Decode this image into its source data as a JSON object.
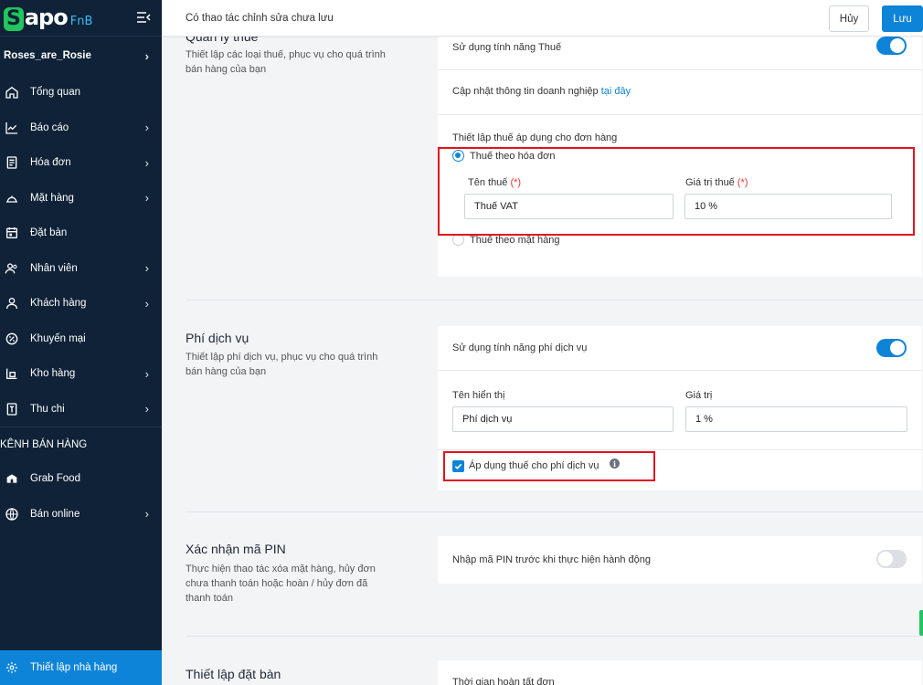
{
  "app": {
    "logo_s": "S",
    "logo_apo": "apo",
    "logo_fnb": "FnB",
    "store_name": "Roses_are_Rosie"
  },
  "sidebar": {
    "items": [
      {
        "label": "Tổng quan",
        "icon": "home-icon",
        "has_arrow": false
      },
      {
        "label": "Báo cáo",
        "icon": "chart-line-icon",
        "has_arrow": true
      },
      {
        "label": "Hóa đơn",
        "icon": "receipt-icon",
        "has_arrow": true
      },
      {
        "label": "Mặt hàng",
        "icon": "cloche-icon",
        "has_arrow": true
      },
      {
        "label": "Đặt bàn",
        "icon": "calendar-icon",
        "has_arrow": false
      },
      {
        "label": "Nhân viên",
        "icon": "users-icon",
        "has_arrow": true
      },
      {
        "label": "Khách hàng",
        "icon": "user-icon",
        "has_arrow": true
      },
      {
        "label": "Khuyến mại",
        "icon": "percent-badge-icon",
        "has_arrow": false
      },
      {
        "label": "Kho hàng",
        "icon": "warehouse-icon",
        "has_arrow": true
      },
      {
        "label": "Thu chi",
        "icon": "cashbook-icon",
        "has_arrow": true
      }
    ],
    "section_title": "KÊNH BÁN HÀNG",
    "channels": [
      {
        "label": "Grab Food",
        "icon": "grabfood-icon",
        "has_arrow": false
      },
      {
        "label": "Bán online",
        "icon": "globe-icon",
        "has_arrow": true
      }
    ],
    "active_item": {
      "label": "Thiết lập nhà hàng",
      "icon": "gear-icon"
    },
    "arrow": "›"
  },
  "topbar": {
    "message": "Có thao tác chỉnh sửa chưa lưu",
    "cancel_label": "Hủy",
    "save_label": "Lưu"
  },
  "tax": {
    "title": "Quản lý thuế",
    "description": "Thiết lập các loại thuế, phục vụ cho quá trình bán hàng của bạn",
    "enable_label": "Sử dụng tính năng Thuế",
    "enabled": true,
    "update_info_text": "Cập nhật thông tin doanh nghiệp ",
    "update_info_link": "tại đây",
    "apply_title": "Thiết lập thuế áp dụng cho đơn hàng",
    "option_invoice": "Thuế theo hóa đơn",
    "option_item": "Thuế theo mặt hàng",
    "selected_option": "invoice",
    "name_label": "Tên thuế",
    "value_label": "Giá trị thuế",
    "required_mark": "(*)",
    "name_value": "Thuế VAT",
    "value_value": "10 %"
  },
  "service_fee": {
    "title": "Phí dịch vụ",
    "description": "Thiết lập phí dịch vụ, phục vụ cho quá trình bán hàng của bạn",
    "enable_label": "Sử dụng tính năng phí dịch vụ",
    "enabled": true,
    "display_name_label": "Tên hiển thị",
    "value_label": "Giá trị",
    "display_name_value": "Phí dịch vụ",
    "value_value": "1 %",
    "apply_tax_label": "Áp dụng thuế cho phí dịch vụ",
    "apply_tax_checked": true
  },
  "pin": {
    "title": "Xác nhận mã PIN",
    "description": "Thực hiện thao tác xóa mặt hàng, hủy đơn chưa thanh toán hoặc hoàn / hủy đơn đã thanh toán",
    "enable_label": "Nhập mã PIN trước khi thực hiện hành động",
    "enabled": false
  },
  "booking": {
    "title": "Thiết lập đặt bàn",
    "row_label": "Thời gian hoàn tất đơn"
  },
  "colors": {
    "sidebar_bg": "#0f2237",
    "accent": "#0d84d8",
    "highlight_box": "#e0131f",
    "brand_green": "#22c55e"
  }
}
